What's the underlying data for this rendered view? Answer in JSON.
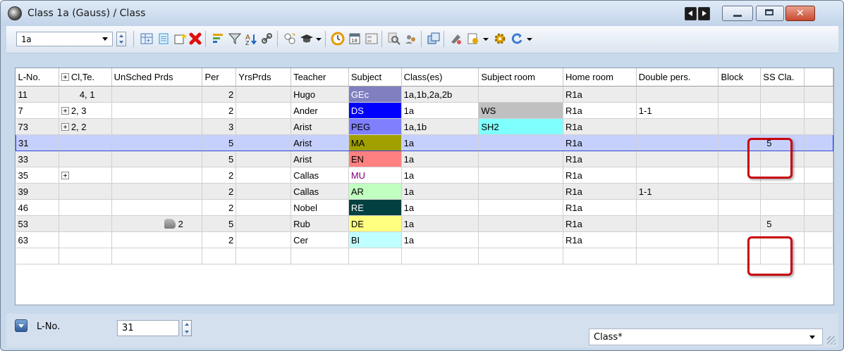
{
  "window": {
    "title": "Class 1a (Gauss) / Class",
    "icon": "clock-icon"
  },
  "toolbar": {
    "class_select": "1a",
    "icons": [
      "insert-row-icon",
      "list-icon",
      "new-icon",
      "delete-icon",
      "sort-icon",
      "filter-icon",
      "wand-icon",
      "link-icon",
      "scheduling-icon",
      "teacher-hat-icon",
      "clock-icon",
      "calendar-icon",
      "grid-icon",
      "search-icon",
      "users-icon",
      "copy-icon",
      "palette-icon",
      "settings-icon",
      "gear-icon",
      "refresh-icon"
    ]
  },
  "table": {
    "columns": [
      "L-No.",
      "Cl,Te.",
      "UnSched Prds",
      "Per",
      "YrsPrds",
      "Teacher",
      "Subject",
      "Class(es)",
      "Subject room",
      "Home room",
      "Double pers.",
      "Block",
      "SS Cla."
    ],
    "rows": [
      {
        "lno": "11",
        "clte": "4, 1",
        "clte_exp": false,
        "unsched": "",
        "per": "2",
        "yrs": "",
        "teacher": "Hugo",
        "subject": "GEc",
        "subj_bg": "#8080c0",
        "subj_fg": "#ffffff",
        "classes": "1a,1b,2a,2b",
        "sroom": "",
        "sroom_bg": "",
        "hroom": "R1a",
        "double": "",
        "block": "",
        "ss": ""
      },
      {
        "lno": "7",
        "clte": "2, 3",
        "clte_exp": true,
        "unsched": "",
        "per": "2",
        "yrs": "",
        "teacher": "Ander",
        "subject": "DS",
        "subj_bg": "#0000ff",
        "subj_fg": "#ffffff",
        "classes": "1a",
        "sroom": "WS",
        "sroom_bg": "#c0c0c0",
        "hroom": "R1a",
        "double": "1-1",
        "block": "",
        "ss": ""
      },
      {
        "lno": "73",
        "clte": "2, 2",
        "clte_exp": true,
        "unsched": "",
        "per": "3",
        "yrs": "",
        "teacher": "Arist",
        "subject": "PEG",
        "subj_bg": "#8080ff",
        "subj_fg": "#000000",
        "classes": "1a,1b",
        "sroom": "SH2",
        "sroom_bg": "#80ffff",
        "hroom": "R1a",
        "double": "",
        "block": "",
        "ss": ""
      },
      {
        "lno": "31",
        "clte": "",
        "clte_exp": false,
        "unsched": "",
        "per": "5",
        "yrs": "",
        "teacher": "Arist",
        "subject": "MA",
        "subj_bg": "#a0a000",
        "subj_fg": "#000000",
        "classes": "1a",
        "sroom": "",
        "sroom_bg": "",
        "hroom": "R1a",
        "double": "",
        "block": "",
        "ss": "5"
      },
      {
        "lno": "33",
        "clte": "",
        "clte_exp": false,
        "unsched": "",
        "per": "5",
        "yrs": "",
        "teacher": "Arist",
        "subject": "EN",
        "subj_bg": "#ff8080",
        "subj_fg": "#000000",
        "classes": "1a",
        "sroom": "",
        "sroom_bg": "",
        "hroom": "R1a",
        "double": "",
        "block": "",
        "ss": ""
      },
      {
        "lno": "35",
        "clte": "",
        "clte_exp": true,
        "unsched": "",
        "per": "2",
        "yrs": "",
        "teacher": "Callas",
        "subject": "MU",
        "subj_bg": "#ffffff",
        "subj_fg": "#800080",
        "classes": "1a",
        "sroom": "",
        "sroom_bg": "",
        "hroom": "R1a",
        "double": "",
        "block": "",
        "ss": ""
      },
      {
        "lno": "39",
        "clte": "",
        "clte_exp": false,
        "unsched": "",
        "per": "2",
        "yrs": "",
        "teacher": "Callas",
        "subject": "AR",
        "subj_bg": "#c0ffc0",
        "subj_fg": "#000000",
        "classes": "1a",
        "sroom": "",
        "sroom_bg": "",
        "hroom": "R1a",
        "double": "1-1",
        "block": "",
        "ss": ""
      },
      {
        "lno": "46",
        "clte": "",
        "clte_exp": false,
        "unsched": "",
        "per": "2",
        "yrs": "",
        "teacher": "Nobel",
        "subject": "RE",
        "subj_bg": "#004040",
        "subj_fg": "#ffffff",
        "classes": "1a",
        "sroom": "",
        "sroom_bg": "",
        "hroom": "R1a",
        "double": "",
        "block": "",
        "ss": ""
      },
      {
        "lno": "53",
        "clte": "",
        "clte_exp": false,
        "unsched": "2",
        "per": "5",
        "yrs": "",
        "teacher": "Rub",
        "subject": "DE",
        "subj_bg": "#ffff80",
        "subj_fg": "#000000",
        "classes": "1a",
        "sroom": "",
        "sroom_bg": "",
        "hroom": "R1a",
        "double": "",
        "block": "",
        "ss": "5"
      },
      {
        "lno": "63",
        "clte": "",
        "clte_exp": false,
        "unsched": "",
        "per": "2",
        "yrs": "",
        "teacher": "Cer",
        "subject": "BI",
        "subj_bg": "#c0ffff",
        "subj_fg": "#000000",
        "classes": "1a",
        "sroom": "",
        "sroom_bg": "",
        "hroom": "R1a",
        "double": "",
        "block": "",
        "ss": ""
      }
    ],
    "selected_row": 3
  },
  "statusbar": {
    "label": "L-No.",
    "value": "31",
    "view_select": "Class*"
  }
}
